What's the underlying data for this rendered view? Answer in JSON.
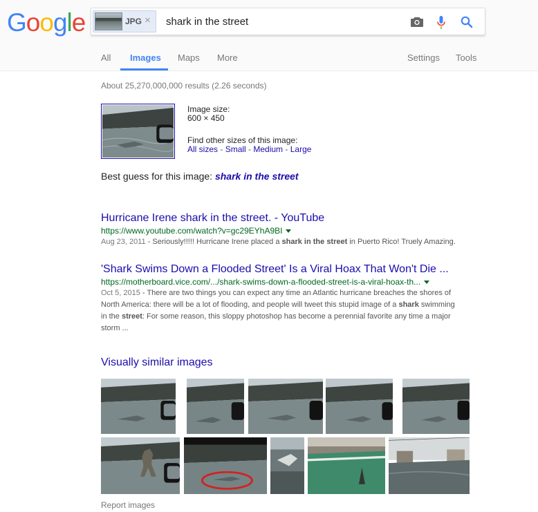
{
  "logo": {
    "letters": [
      "G",
      "o",
      "o",
      "g",
      "l",
      "e"
    ],
    "colors": [
      "#4285f4",
      "#ea4335",
      "#fbbc05",
      "#4285f4",
      "#34a853",
      "#ea4335"
    ]
  },
  "search": {
    "chip_label": "JPG",
    "chip_close": "×",
    "query": "shark in the street"
  },
  "icons": {
    "camera": "camera-icon",
    "mic": "microphone-icon",
    "search": "search-icon"
  },
  "tabs": {
    "all": "All",
    "images": "Images",
    "maps": "Maps",
    "more": "More",
    "settings": "Settings",
    "tools": "Tools"
  },
  "stats": "About 25,270,000,000 results (2.26 seconds)",
  "image_info": {
    "size_label": "Image size:",
    "size_value": "600 × 450",
    "find_label": "Find other sizes of this image:",
    "links": [
      "All sizes",
      "Small",
      "Medium",
      "Large"
    ],
    "sep": " - "
  },
  "best_guess": {
    "label": "Best guess for this image: ",
    "value": "shark in the street"
  },
  "results": [
    {
      "title": "Hurricane Irene shark in the street. - YouTube",
      "url": "https://www.youtube.com/watch?v=gc29EYhA9BI",
      "date": "Aug 23, 2011",
      "snippet_parts": [
        " - Seriously!!!!! Hurricane Irene placed a ",
        "shark in the street",
        " in Puerto Rico! Truely Amazing."
      ]
    },
    {
      "title": "'Shark Swims Down a Flooded Street' Is a Viral Hoax That Won't Die ...",
      "url": "https://motherboard.vice.com/.../shark-swims-down-a-flooded-street-is-a-viral-hoax-th...",
      "date": "Oct 5, 2015",
      "snippet_lines": [
        [
          " - There are two things you can expect any time an Atlantic hurricane breaches the shores of"
        ],
        [
          "North America: there will be a lot of flooding, and people will tweet this stupid image of a ",
          "shark",
          " swimming"
        ],
        [
          "in the ",
          "street",
          ": For some reason, this sloppy photoshop has become a perennial favorite any time a major"
        ],
        [
          "storm ..."
        ]
      ]
    }
  ],
  "visually_similar": {
    "title": "Visually similar images",
    "count": 10
  },
  "report": "Report images"
}
